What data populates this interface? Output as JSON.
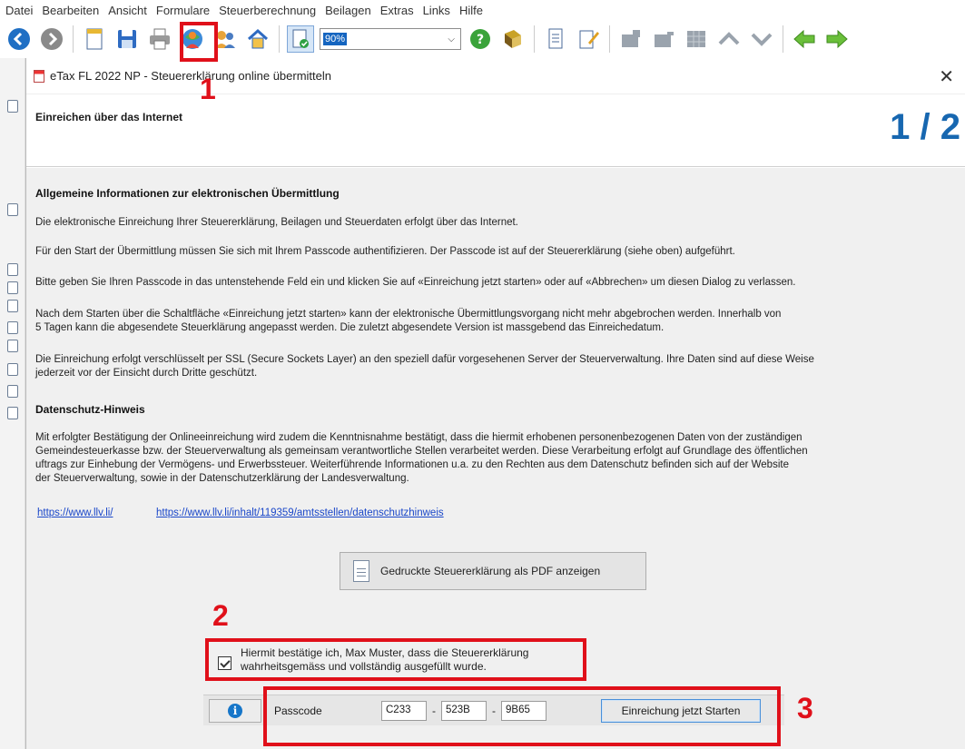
{
  "menu": [
    "Datei",
    "Bearbeiten",
    "Ansicht",
    "Formulare",
    "Steuerberechnung",
    "Beilagen",
    "Extras",
    "Links",
    "Hilfe"
  ],
  "toolbar": {
    "zoom_value": "90%",
    "icons": [
      "back-icon",
      "forward-icon",
      "new-document-icon",
      "save-icon",
      "print-icon",
      "submit-online-icon",
      "users-icon",
      "home-icon",
      "document-check-icon",
      "help-icon",
      "book-icon",
      "page-icon",
      "edit-icon",
      "grid-icon",
      "up-icon",
      "down-icon",
      "arrow-left-icon",
      "arrow-right-icon"
    ]
  },
  "dialog": {
    "title": "eTax FL 2022 NP - Steuererklärung online übermitteln",
    "header_title": "Einreichen über das Internet",
    "step": "1 / 2",
    "section1_title": "Allgemeine Informationen zur elektronischen Übermittlung",
    "p1": "Die elektronische Einreichung Ihrer Steuererklärung, Beilagen und Steuerdaten erfolgt über das Internet.",
    "p2": "Für den Start der Übermittlung müssen Sie sich mit Ihrem Passcode authentifizieren. Der Passcode ist auf der Steuererklärung (siehe oben) aufgeführt.",
    "p3": "Bitte geben Sie Ihren Passcode in das untenstehende Feld ein und klicken Sie auf «Einreichung jetzt starten» oder auf «Abbrechen» um diesen Dialog zu verlassen.",
    "p4a": "Nach dem Starten über die Schaltfläche «Einreichung jetzt starten» kann der elektronische Übermittlungsvorgang nicht mehr abgebrochen werden. Innerhalb von",
    "p4b": "5 Tagen kann die abgesendete Steuerklärung angepasst werden. Die zuletzt abgesendete Version ist massgebend das Einreichedatum.",
    "p5a": "Die Einreichung erfolgt verschlüsselt per SSL (Secure Sockets Layer) an den speziell dafür vorgesehenen Server der Steuerverwaltung. Ihre Daten sind auf diese Weise",
    "p5b": "jederzeit vor der Einsicht durch Dritte geschützt.",
    "section2_title": "Datenschutz-Hinweis",
    "p6a": "Mit erfolgter Bestätigung der Onlineeinreichung wird zudem die Kenntnisnahme bestätigt, dass die hiermit erhobenen personenbezogenen Daten von der zuständigen",
    "p6b": "Gemeindesteuerkasse bzw. der Steuerverwaltung als gemeinsam verantwortliche Stellen verarbeitet werden. Diese Verarbeitung erfolgt auf Grundlage des öffentlichen",
    "p6c": "uftrags zur Einhebung der Vermögens- und Erwerbssteuer. Weiterführende Informationen u.a. zu den Rechten aus dem Datenschutz befinden sich auf der Website",
    "p6d": "der Steuerverwaltung, sowie in der Datenschutzerklärung der Landesverwaltung.",
    "link1": "https://www.llv.li/",
    "link2": "https://www.llv.li/inhalt/119359/amtsstellen/datenschutzhinweis",
    "pdf_button": "Gedruckte Steuererklärung als PDF anzeigen",
    "confirm_line1": "Hiermit bestätige ich, Max Muster, dass die Steuererklärung",
    "confirm_line2": "wahrheitsgemäss und vollständig ausgefüllt wurde.",
    "passcode_label": "Passcode",
    "passcode_1": "C233",
    "passcode_2": "523B",
    "passcode_3": "9B65",
    "dash": "-",
    "start_button": "Einreichung jetzt Starten"
  },
  "annotations": [
    "1",
    "2",
    "3"
  ],
  "colors": {
    "annotation": "#e0101a",
    "step": "#1767b0",
    "link": "#1a47c9"
  }
}
